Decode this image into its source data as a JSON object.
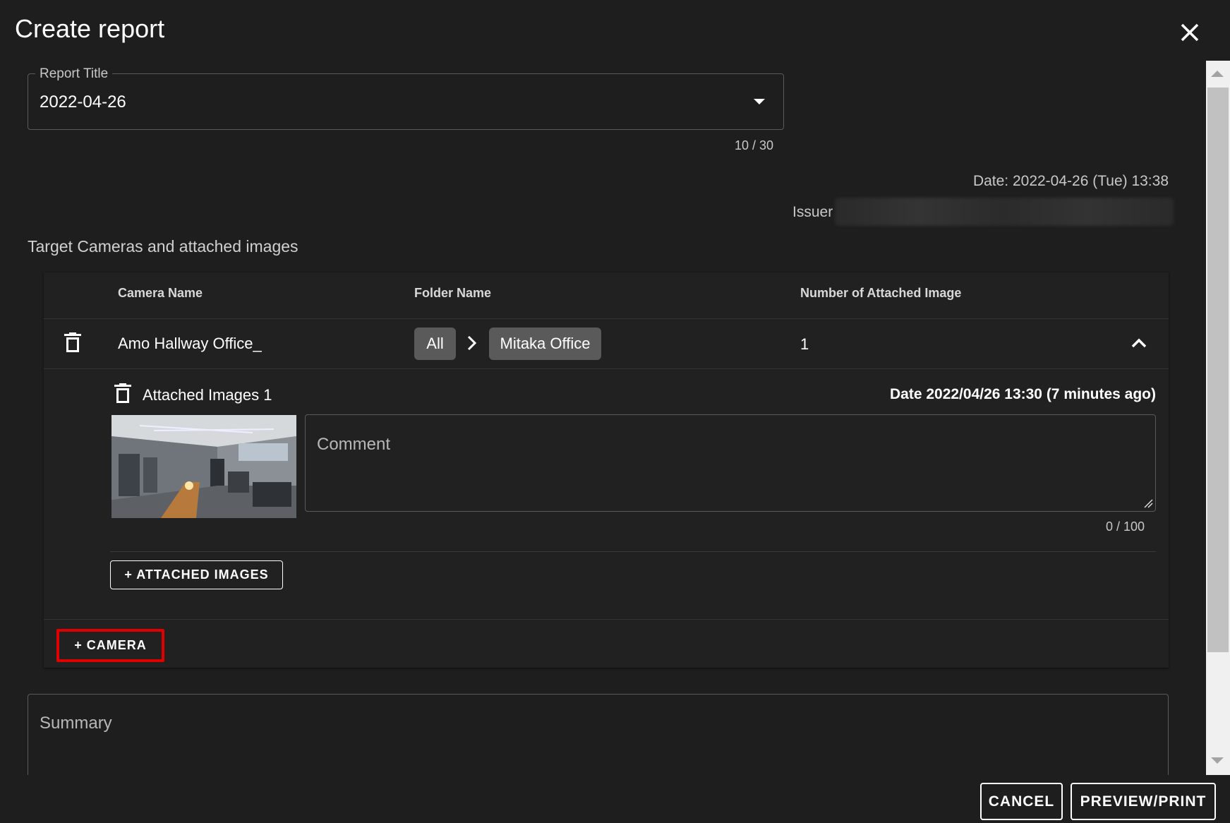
{
  "dialog": {
    "title": "Create report",
    "close_icon": "close-icon"
  },
  "report_title": {
    "label": "Report Title",
    "value": "2022-04-26",
    "counter": "10 / 30"
  },
  "meta": {
    "date": "Date: 2022-04-26 (Tue) 13:38",
    "issuer_label": "Issuer"
  },
  "cameras_section": {
    "title": "Target Cameras and attached images",
    "columns": [
      "Camera Name",
      "Folder Name",
      "Number of Attached Image"
    ],
    "rows": [
      {
        "camera_name": "Amo Hallway Office_",
        "folder_path": [
          "All",
          "Mitaka Office"
        ],
        "attached_count": "1",
        "attached": {
          "label": "Attached Images 1",
          "date": "Date 2022/04/26 13:30 (7 minutes ago)",
          "comment_placeholder": "Comment",
          "comment_counter": "0 / 100"
        }
      }
    ],
    "add_images_label": "+ ATTACHED IMAGES",
    "add_camera_label": "+ CAMERA"
  },
  "summary": {
    "placeholder": "Summary"
  },
  "footer": {
    "cancel_label": "CANCEL",
    "preview_label": "PREVIEW/PRINT"
  },
  "colors": {
    "background": "#1e1e1e",
    "chip": "#5a5a5a",
    "highlight": "#e00000"
  }
}
